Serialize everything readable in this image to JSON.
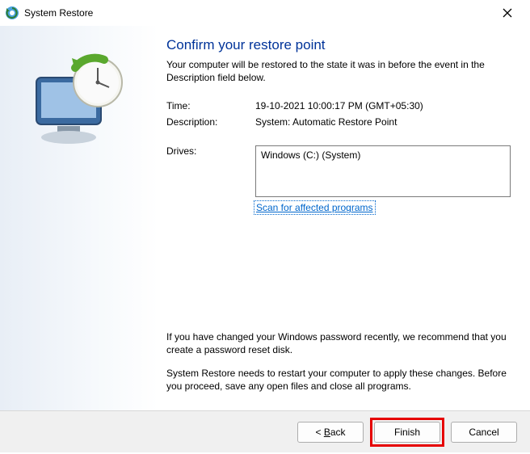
{
  "titlebar": {
    "title": "System Restore"
  },
  "content": {
    "heading": "Confirm your restore point",
    "intro": "Your computer will be restored to the state it was in before the event in the Description field below.",
    "time_label": "Time:",
    "time_value": "19-10-2021 10:00:17 PM (GMT+05:30)",
    "desc_label": "Description:",
    "desc_value": "System: Automatic Restore Point",
    "drives_label": "Drives:",
    "drives_value": "Windows (C:) (System)",
    "scan_link": "Scan for affected programs",
    "password_note": "If you have changed your Windows password recently, we recommend that you create a password reset disk.",
    "restart_note": "System Restore needs to restart your computer to apply these changes. Before you proceed, save any open files and close all programs."
  },
  "footer": {
    "back_prefix": "< ",
    "back_u": "B",
    "back_rest": "ack",
    "finish": "Finish",
    "cancel": "Cancel"
  }
}
